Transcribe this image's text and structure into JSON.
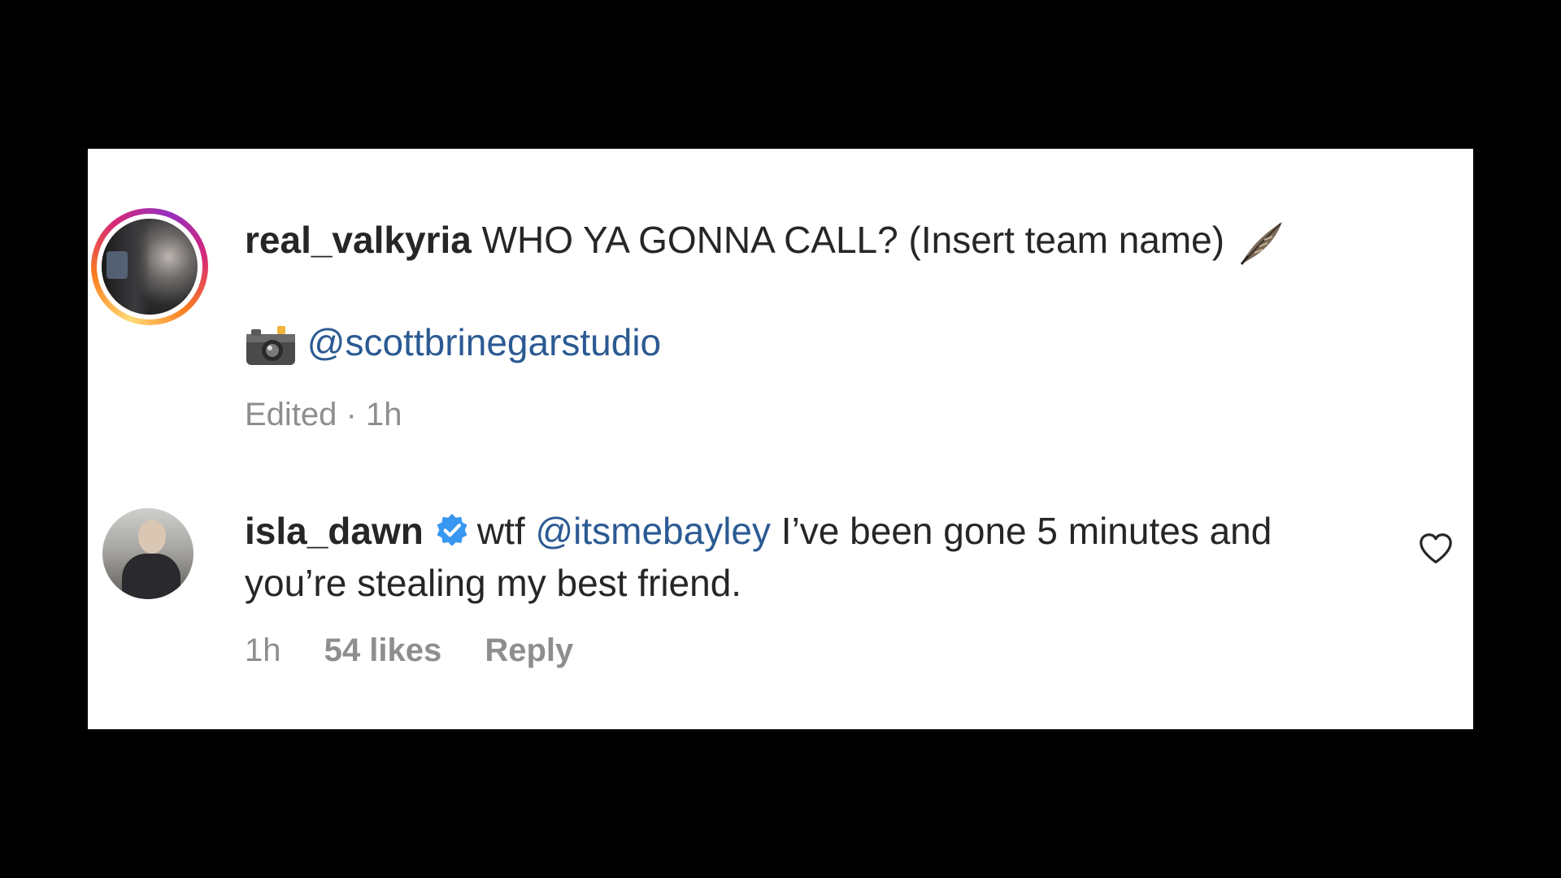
{
  "post_comment": {
    "username": "real_valkyria",
    "text": "WHO YA GONNA CALL? (Insert team name)",
    "emoji_feather": "feather-emoji",
    "emoji_camera": "camera-emoji",
    "mention": "@scottbrinegarstudio",
    "edited_label": "Edited",
    "separator": "·",
    "time": "1h"
  },
  "reply_comment": {
    "username": "isla_dawn",
    "verified_icon": "verified-badge-icon",
    "text_prefix": "wtf",
    "mention": "@itsmebayley",
    "text_suffix": "I’ve been gone 5 minutes and you’re stealing my best friend.",
    "time": "1h",
    "likes": "54 likes",
    "reply_label": "Reply",
    "heart_icon": "heart-outline-icon"
  },
  "colors": {
    "background": "#000000",
    "card": "#ffffff",
    "text": "#262626",
    "muted": "#8e8e8e",
    "mention": "#2b5a93",
    "verified": "#3897f0"
  }
}
